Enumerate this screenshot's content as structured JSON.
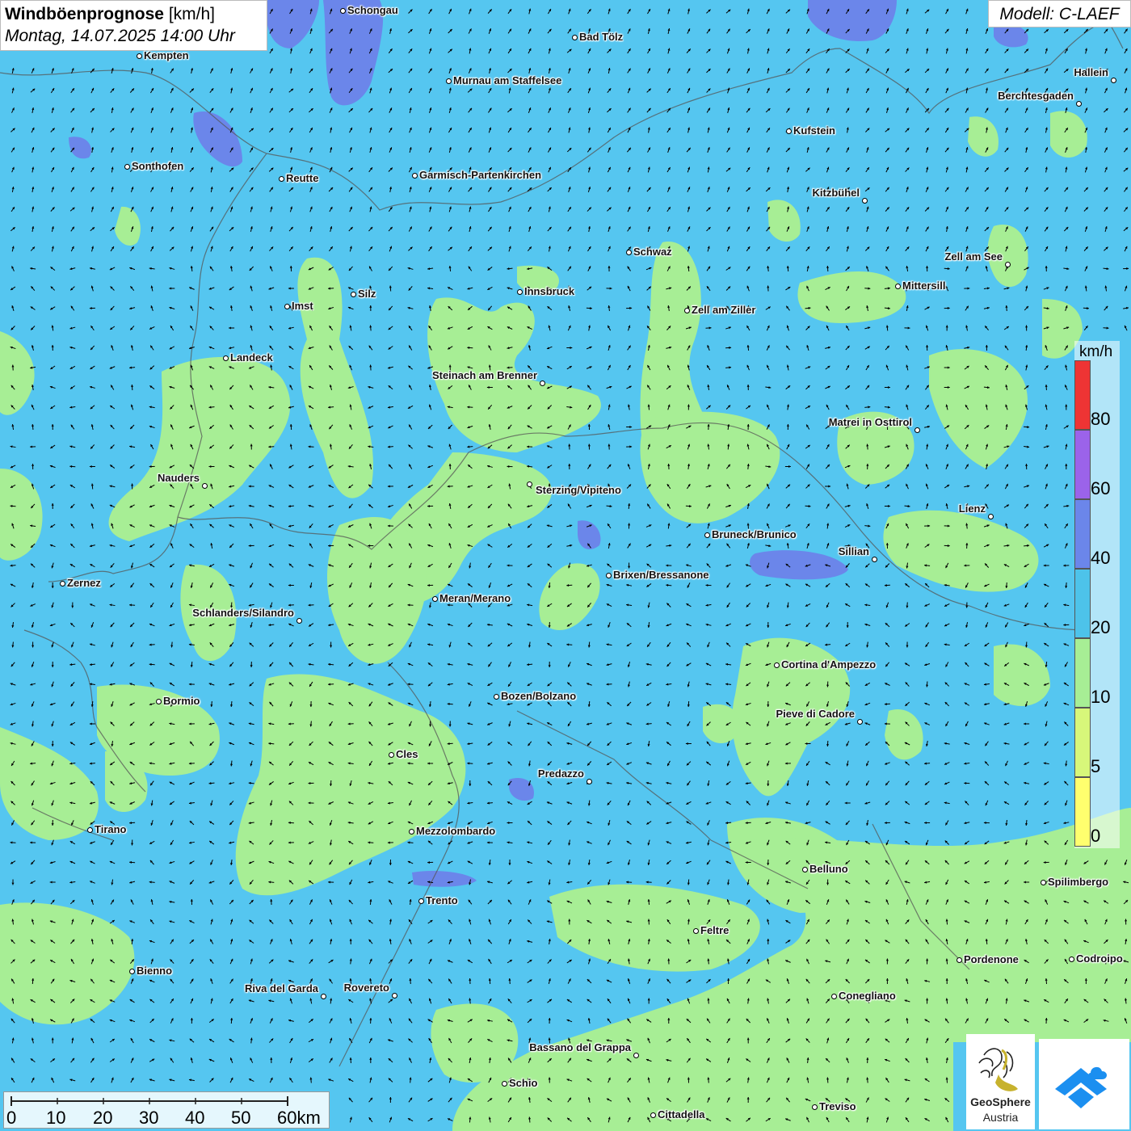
{
  "title": {
    "main": "Windböenprognose",
    "unit": "[km/h]",
    "datetime": "Montag, 14.07.2025 14:00 Uhr"
  },
  "model": "Modell: C-LAEF",
  "colors": {
    "bg_20_40": "#55c6f0",
    "bg_10_20": "#a7ee95",
    "bg_40_60": "#6b86ea",
    "bg_5_10": "#d7f77a",
    "bg_0_5": "#ffff6e",
    "bg_60_80": "#9b63ea",
    "bg_80": "#ee3434"
  },
  "legend": {
    "unit": "km/h",
    "bands": [
      {
        "label": "80",
        "color": "#ee3434"
      },
      {
        "label": "60",
        "color": "#9b63ea"
      },
      {
        "label": "40",
        "color": "#6b86ea"
      },
      {
        "label": "20",
        "color": "#4dc3ea"
      },
      {
        "label": "10",
        "color": "#a7ee95"
      },
      {
        "label": "5",
        "color": "#d7f77a"
      },
      {
        "label": "0",
        "color": "#ffff6e"
      }
    ]
  },
  "scalebar": {
    "ticks": [
      "0",
      "10",
      "20",
      "30",
      "40",
      "50",
      "60km"
    ]
  },
  "logo": {
    "name": "GeoSphere",
    "sub": "Austria"
  },
  "cities": [
    {
      "name": "Schongau"
    },
    {
      "name": "Kempten"
    },
    {
      "name": "Bad Tölz"
    },
    {
      "name": "Murnau am Staffelsee"
    },
    {
      "name": "Hallein"
    },
    {
      "name": "Berchtesgaden"
    },
    {
      "name": "Kufstein"
    },
    {
      "name": "Sonthofen"
    },
    {
      "name": "Reutte"
    },
    {
      "name": "Garmisch-Partenkirchen"
    },
    {
      "name": "Kitzbühel"
    },
    {
      "name": "Schwaz"
    },
    {
      "name": "Zell am See"
    },
    {
      "name": "Innsbruck"
    },
    {
      "name": "Mittersill"
    },
    {
      "name": "Imst"
    },
    {
      "name": "Silz"
    },
    {
      "name": "Zell am Ziller"
    },
    {
      "name": "Landeck"
    },
    {
      "name": "Steinach am Brenner"
    },
    {
      "name": "Matrei in Osttirol"
    },
    {
      "name": "Nauders"
    },
    {
      "name": "Sterzing/Vipiteno"
    },
    {
      "name": "Lienz"
    },
    {
      "name": "Bruneck/Brunico"
    },
    {
      "name": "Sillian"
    },
    {
      "name": "Zernez"
    },
    {
      "name": "Brixen/Bressanone"
    },
    {
      "name": "Meran/Merano"
    },
    {
      "name": "Schlanders/Silandro"
    },
    {
      "name": "Cortina d'Ampezzo"
    },
    {
      "name": "Bozen/Bolzano"
    },
    {
      "name": "Bormio"
    },
    {
      "name": "Pieve di Cadore"
    },
    {
      "name": "Cles"
    },
    {
      "name": "Predazzo"
    },
    {
      "name": "Tirano"
    },
    {
      "name": "Mezzolombardo"
    },
    {
      "name": "Belluno"
    },
    {
      "name": "Spilimbergo"
    },
    {
      "name": "Trento"
    },
    {
      "name": "Feltre"
    },
    {
      "name": "Pordenone"
    },
    {
      "name": "Codroipo"
    },
    {
      "name": "Bienno"
    },
    {
      "name": "Riva del Garda"
    },
    {
      "name": "Rovereto"
    },
    {
      "name": "Conegliano"
    },
    {
      "name": "Bassano del Grappa"
    },
    {
      "name": "Schio"
    },
    {
      "name": "Treviso"
    },
    {
      "name": "Cittadella"
    }
  ]
}
